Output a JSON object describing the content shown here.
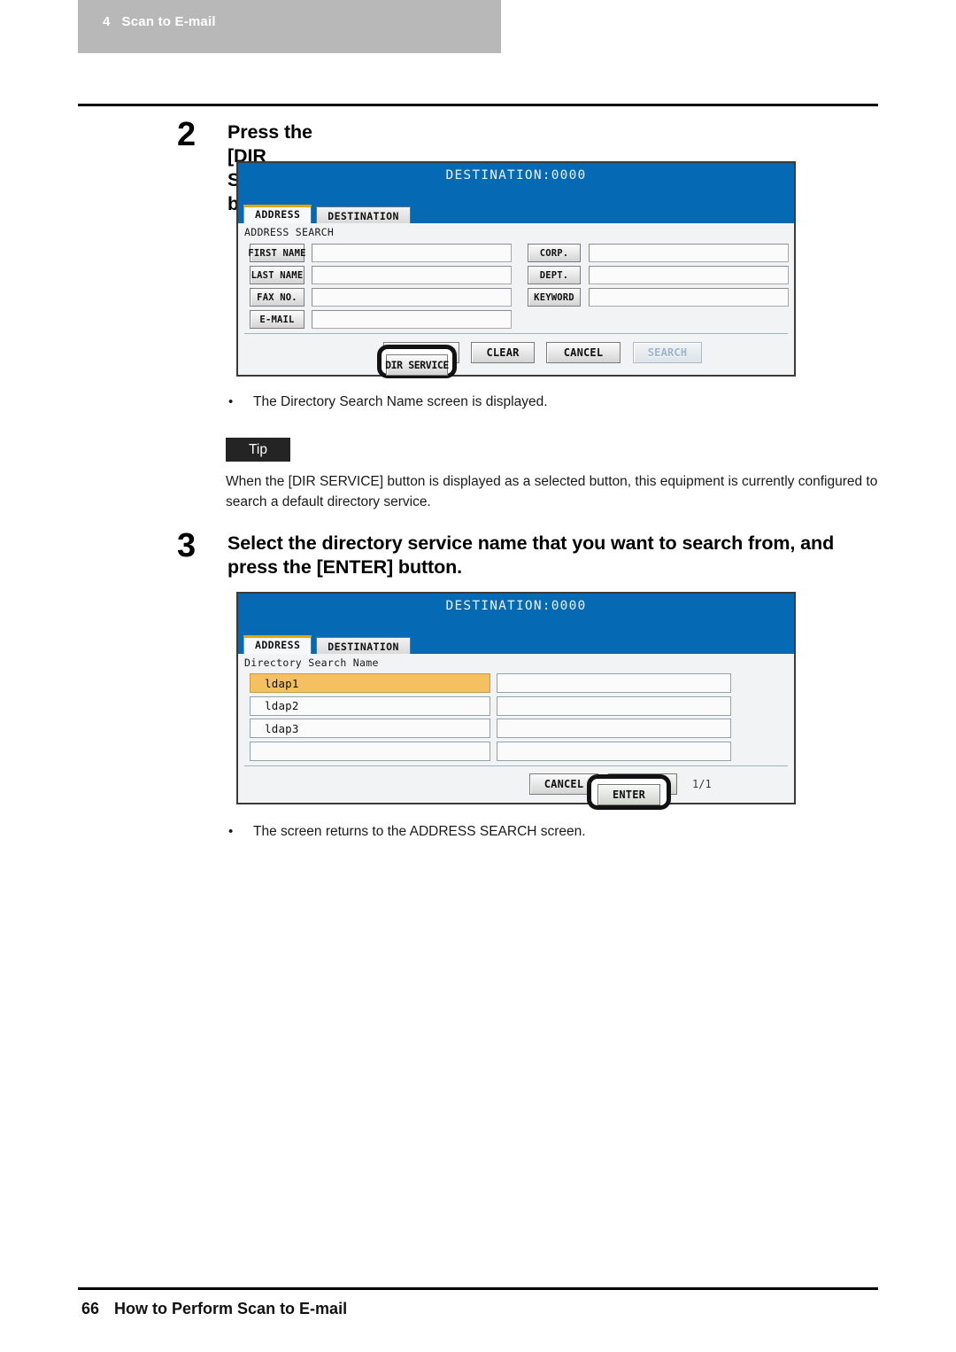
{
  "running_header": {
    "chapter_number": "4",
    "chapter_title": "Scan to E-mail"
  },
  "steps": [
    {
      "number": "2",
      "title": "Press the [DIR SERVICE] button.",
      "result_bullet": "The Directory Search Name screen is displayed."
    },
    {
      "number": "3",
      "title": "Select the directory service name that you want to search from, and press the [ENTER] button.",
      "result_bullet": "The screen returns to the ADDRESS SEARCH screen."
    }
  ],
  "screen1": {
    "title": "DESTINATION:0000",
    "tabs": [
      {
        "label": "ADDRESS",
        "active": true
      },
      {
        "label": "DESTINATION",
        "active": false
      }
    ],
    "section_label": "ADDRESS SEARCH",
    "left_fields": [
      {
        "label": "FIRST NAME",
        "value": ""
      },
      {
        "label": "LAST NAME",
        "value": ""
      },
      {
        "label": "FAX NO.",
        "value": ""
      },
      {
        "label": "E-MAIL",
        "value": ""
      }
    ],
    "right_fields": [
      {
        "label": "CORP.",
        "value": ""
      },
      {
        "label": "DEPT.",
        "value": ""
      },
      {
        "label": "KEYWORD",
        "value": ""
      }
    ],
    "buttons": [
      {
        "label": "DIR SERVICE",
        "state": "highlighted"
      },
      {
        "label": "CLEAR",
        "state": "normal"
      },
      {
        "label": "CANCEL",
        "state": "normal"
      },
      {
        "label": "SEARCH",
        "state": "disabled"
      }
    ]
  },
  "screen2": {
    "title": "DESTINATION:0000",
    "tabs": [
      {
        "label": "ADDRESS",
        "active": true
      },
      {
        "label": "DESTINATION",
        "active": false
      }
    ],
    "section_label": "Directory Search Name",
    "rows": [
      {
        "name": "ldap1",
        "selected": true,
        "second": ""
      },
      {
        "name": "ldap2",
        "selected": false,
        "second": ""
      },
      {
        "name": "ldap3",
        "selected": false,
        "second": ""
      },
      {
        "name": "",
        "selected": false,
        "second": ""
      }
    ],
    "buttons": [
      {
        "label": "CANCEL",
        "state": "normal"
      },
      {
        "label": "ENTER",
        "state": "highlighted"
      }
    ],
    "page_indicator": "1/1"
  },
  "tip": {
    "badge": "Tip",
    "text": "When the [DIR SERVICE] button is displayed as a selected button, this equipment is currently configured to search a default directory service."
  },
  "footer": {
    "page_number": "66",
    "section_title": "How to Perform Scan to E-mail"
  },
  "colors": {
    "lcd_header_blue": "#0569b4",
    "tab_accent_gold": "#e0a800",
    "row_selected_orange": "#f4c061",
    "chapter_band_gray": "#b8b8b8",
    "tip_badge_black": "#242424"
  }
}
